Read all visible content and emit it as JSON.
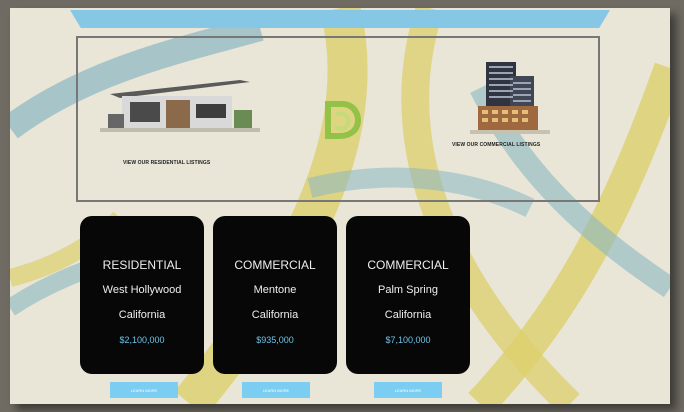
{
  "panel": {
    "residential_link": "VIEW OUR RESIDENTIAL LISTINGS",
    "commercial_link": "VIEW OUR COMMERCIAL LISTINGS"
  },
  "cards": [
    {
      "type": "RESIDENTIAL",
      "city": "West Hollywood",
      "state": "California",
      "price": "$2,100,000"
    },
    {
      "type": "COMMERCIAL",
      "city": "Mentone",
      "state": "California",
      "price": "$935,000"
    },
    {
      "type": "COMMERCIAL",
      "city": "Palm Spring",
      "state": "California",
      "price": "$7,100,000"
    }
  ],
  "buttons": [
    {
      "label": "LEARN MORE"
    },
    {
      "label": "LEARN MORE"
    },
    {
      "label": "LEARN MORE"
    }
  ],
  "colors": {
    "background": "#e9e6d8",
    "yellow_swirl": "#dccf6c",
    "blue_swirl": "#8ab7c2",
    "card": "#070707",
    "price": "#6fc3ea",
    "button": "#7ccdf2"
  },
  "icons": [
    "residential-house-image",
    "commercial-building-image",
    "brand-logo-icon"
  ]
}
